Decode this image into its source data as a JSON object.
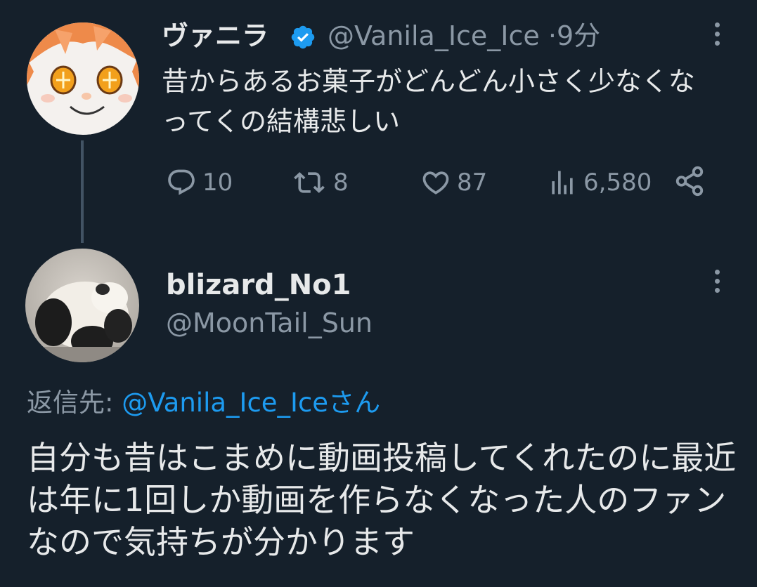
{
  "original_tweet": {
    "display_name": "ヴァニラ",
    "handle": "@Vanila_Ice_Ice",
    "separator": "·",
    "time": "9分",
    "text": "昔からあるお菓子がどんどん小さく少なくなってくの結構悲しい",
    "stats": {
      "replies": "10",
      "retweets": "8",
      "likes": "87",
      "views": "6,580"
    }
  },
  "reply_tweet": {
    "display_name": "blizard_No1",
    "handle": "@MoonTail_Sun",
    "reply_to_label": "返信先:",
    "reply_to_mention": "@Vanila_Ice_Iceさん",
    "text": "自分も昔はこまめに動画投稿してくれたのに最近は年に1回しか動画を作らなくなった人のファンなので気持ちが分かります"
  },
  "icons": {
    "verified": "verified-badge-icon",
    "more": "more-vertical-icon",
    "reply": "reply-icon",
    "retweet": "retweet-icon",
    "like": "heart-icon",
    "views": "views-icon",
    "share": "share-icon"
  },
  "colors": {
    "background": "#15202b",
    "text": "#e7e9ea",
    "secondary": "#8b98a5",
    "accent": "#1d9bf0",
    "thread_line": "#425364"
  }
}
